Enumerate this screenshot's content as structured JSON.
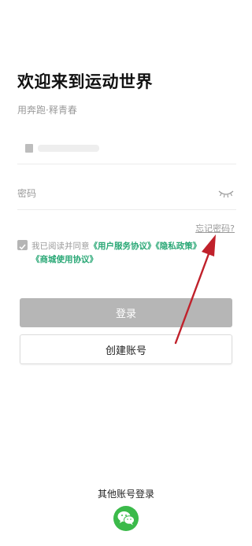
{
  "header": {
    "title": "欢迎来到运动世界",
    "subtitle": "用奔跑·释青春"
  },
  "form": {
    "account_value": "",
    "password_placeholder": "密码",
    "forgot_password": "忘记密码?"
  },
  "agreement": {
    "prefix": "我已阅读并同意",
    "user_service": "《用户服务协议》",
    "privacy": "《隐私政策》",
    "mall": "《商城使用协议》",
    "checked": false
  },
  "buttons": {
    "login": "登录",
    "create_account": "创建账号"
  },
  "other_login": {
    "label": "其他账号登录",
    "methods": [
      "wechat-icon"
    ]
  },
  "colors": {
    "accent": "#2aa876",
    "login_button_disabled": "#b6b6b6",
    "wechat": "#3bba4a",
    "annotation_arrow": "#c0212b"
  }
}
